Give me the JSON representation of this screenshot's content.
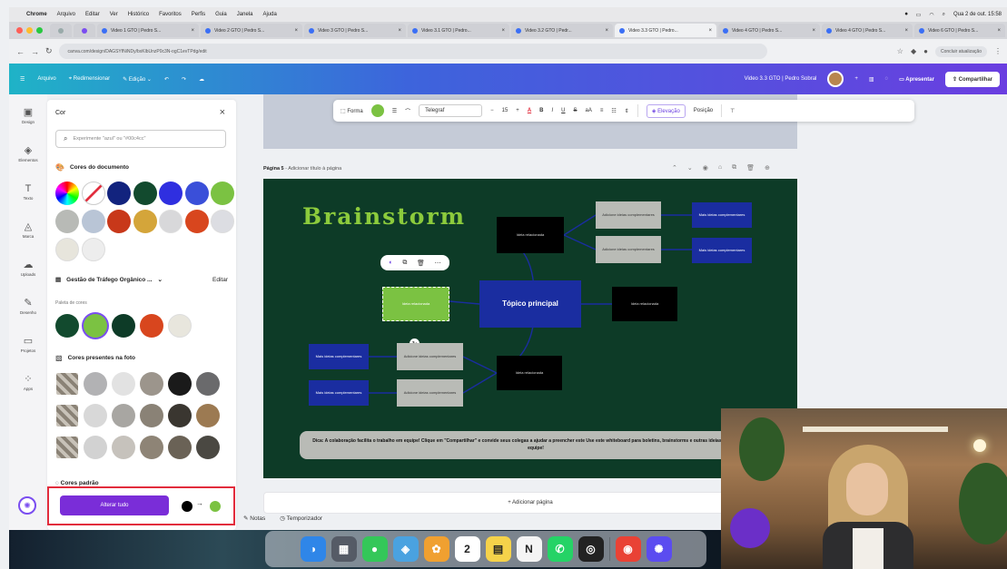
{
  "menubar": {
    "app": "Chrome",
    "items": [
      "Arquivo",
      "Editar",
      "Ver",
      "Histórico",
      "Favoritos",
      "Perfis",
      "Guia",
      "Janela",
      "Ajuda"
    ],
    "clock": "Qua 2 de out. 15:58"
  },
  "tabs": [
    {
      "label": "Video 1 GTO | Pedro S...",
      "active": false
    },
    {
      "label": "Video 2 GTO | Pedro S...",
      "active": false
    },
    {
      "label": "Video 3 GTO | Pedro S...",
      "active": false
    },
    {
      "label": "Video 3.1 GTO | Pedro...",
      "active": false
    },
    {
      "label": "Video 3.2 GTO | Pedr...",
      "active": false
    },
    {
      "label": "Video 3.3 GTO | Pedro...",
      "active": true
    },
    {
      "label": "Video 4 GTO | Pedro S...",
      "active": false
    },
    {
      "label": "Video 4 GTO | Pedro S...",
      "active": false
    },
    {
      "label": "Video 6 GTO | Pedro S...",
      "active": false
    }
  ],
  "address": {
    "url": "canva.com/design/DAGSYfNiNDy/bxKlbUnzP0c3N-ogC1evTPdg/edit",
    "finish_update": "Concluir atualização"
  },
  "header": {
    "file": "Arquivo",
    "resize": "Redimensionar",
    "edit": "Edição",
    "doc_title": "Video 3.3 GTO | Pedro Sobral",
    "present": "Apresentar",
    "share": "Compartilhar"
  },
  "rail": [
    {
      "label": "Design",
      "icon": "layout-icon"
    },
    {
      "label": "Elementos",
      "icon": "shapes-icon"
    },
    {
      "label": "Texto",
      "icon": "text-icon"
    },
    {
      "label": "Marca",
      "icon": "brand-icon"
    },
    {
      "label": "Uploads",
      "icon": "upload-icon"
    },
    {
      "label": "Desenho",
      "icon": "draw-icon"
    },
    {
      "label": "Projetos",
      "icon": "folder-icon"
    },
    {
      "label": "Apps",
      "icon": "apps-icon"
    }
  ],
  "panel": {
    "title": "Cor",
    "search_placeholder": "Experimente \"azul\" ou \"#00c4cc\"",
    "doc_colors_title": "Cores do documento",
    "doc_colors": [
      "#1a1a1a",
      "#0d0d0d",
      "#12237e",
      "#124a2e",
      "#2f2fe0",
      "#3a4fd9",
      "#7bc242",
      "#b8bab6",
      "#b9c5d6",
      "#c8381a",
      "#d4a53a",
      "#d8d8da",
      "#d8461e",
      "#dcdde2",
      "#e7e5dc",
      "#ededed"
    ],
    "brand_kit": "Gestão de Tráfego Orgânico ...",
    "brand_edit": "Editar",
    "palette_label": "Paleta de cores",
    "palette": [
      "#124a2e",
      "#7bc242",
      "#0d3b27",
      "#d8461e",
      "#e8e6dd"
    ],
    "photo_colors_title": "Cores presentes na foto",
    "photo_rows": [
      [
        "#b2b2b4",
        "#e2e2e2",
        "#9c958c",
        "#1a1a1a",
        "#6a6a6c"
      ],
      [
        "#d8d8d8",
        "#a8a6a2",
        "#8a8276",
        "#3a3630",
        "#9c7a52"
      ],
      [
        "#d2d2d2",
        "#c6c2bc",
        "#8e8476",
        "#6a6256",
        "#4a4842"
      ]
    ],
    "default_colors": "Cores padrão",
    "replace_all": "Alterar tudo",
    "replace_from": "#000000",
    "replace_to": "#7bc242"
  },
  "toolbar": {
    "shape": "Forma",
    "font": "Telegraf",
    "size": "15",
    "elevation": "Elevação",
    "position": "Posição"
  },
  "page": {
    "label": "Página 5",
    "add_title": "Adicionar título à página"
  },
  "board": {
    "title": "Brainstorm",
    "main": "Tópico principal",
    "related": "Ideia relacionada",
    "complementary": "Adicione ideias complementares",
    "more": "Mais ideias complementares",
    "note": "Dica: A colaboração facilita o trabalho em equipe! Clique em \"Compartilhar\" e convide seus colegas a ajudar a preencher este Use este whiteboard para boletins, brainstorms e outras ideias divertidas para a equipe!"
  },
  "footer": {
    "add_page": "+ Adicionar página",
    "notes": "Notas",
    "timer": "Temporizador"
  },
  "dock": [
    {
      "name": "finder",
      "color": "#2f86e8",
      "glyph": "◑"
    },
    {
      "name": "launchpad",
      "color": "#555b66",
      "glyph": "▦"
    },
    {
      "name": "messages",
      "color": "#34c759",
      "glyph": "●"
    },
    {
      "name": "maps",
      "color": "#4aa2e0",
      "glyph": "◈"
    },
    {
      "name": "photos",
      "color": "#f0a030",
      "glyph": "✿"
    },
    {
      "name": "calendar",
      "color": "#ffffff",
      "glyph": "2"
    },
    {
      "name": "notes",
      "color": "#f5d24a",
      "glyph": "▤"
    },
    {
      "name": "notion",
      "color": "#f4f4f4",
      "glyph": "N"
    },
    {
      "name": "whatsapp",
      "color": "#25d366",
      "glyph": "✆"
    },
    {
      "name": "chatgpt",
      "color": "#222222",
      "glyph": "◎"
    },
    {
      "name": "chrome",
      "color": "#e94235",
      "glyph": "◉"
    },
    {
      "name": "settings",
      "color": "#5b4cf0",
      "glyph": "✺"
    }
  ]
}
